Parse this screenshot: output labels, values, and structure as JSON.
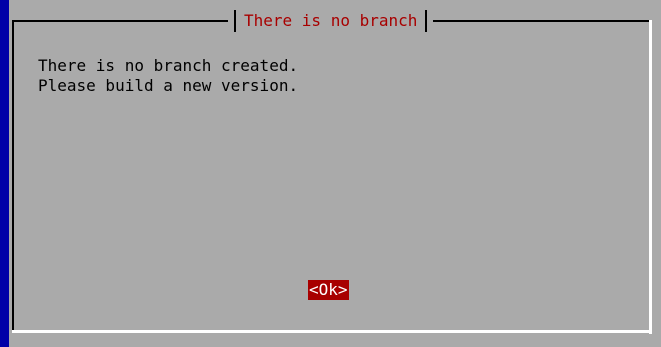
{
  "dialog": {
    "title": "There is no branch",
    "message_line_1": "There is no branch created.",
    "message_line_2": "Please build a new version.",
    "ok_label": "<Ok>"
  },
  "colors": {
    "background": "#0000a8",
    "dialog_bg": "#aaaaaa",
    "title_text": "#a80000",
    "button_bg": "#a80000",
    "button_text": "#ffffff"
  }
}
